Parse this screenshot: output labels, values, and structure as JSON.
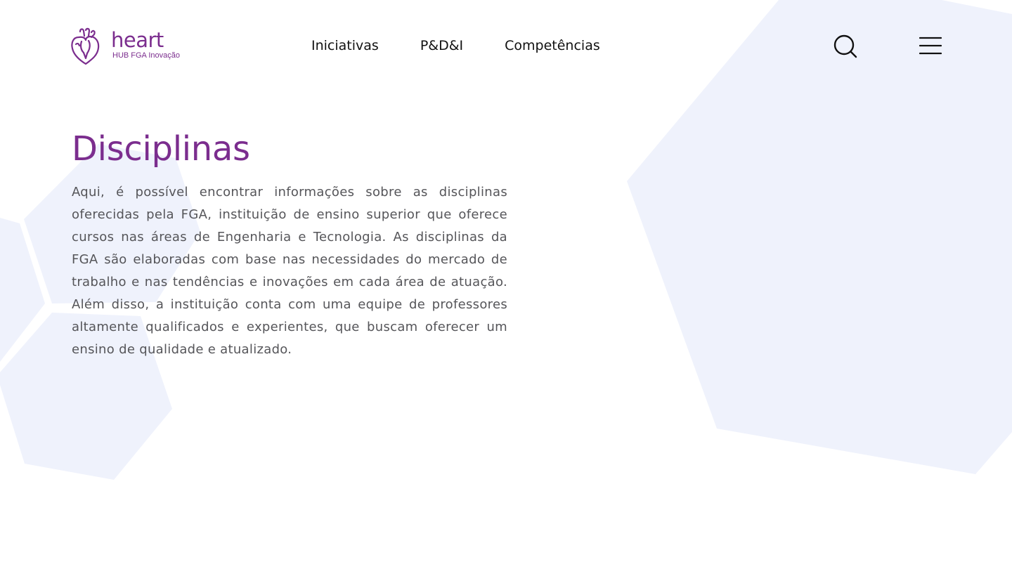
{
  "colors": {
    "brand": "#7b2d8e",
    "nav_text": "#111111",
    "body_text": "#555559",
    "hexagon_fill": "#eff2fc",
    "background": "#ffffff"
  },
  "header": {
    "logo": {
      "name": "heart",
      "subtitle": "HUB FGA Inovação",
      "icon": "anatomical-heart-icon"
    },
    "nav": [
      {
        "label": "Iniciativas"
      },
      {
        "label": "P&D&I"
      },
      {
        "label": "Competências"
      }
    ],
    "search_icon": "search-icon",
    "menu_icon": "hamburger-menu-icon"
  },
  "main": {
    "title": "Disciplinas",
    "description": "Aqui, é possível encontrar informações sobre as disciplinas oferecidas pela FGA, instituição de ensino superior que oferece cursos nas áreas de Engenharia e Tecnologia. As disciplinas da FGA são elaboradas com base nas necessidades do mercado de trabalho e nas tendências e inovações em cada área de atuação. Além disso, a instituição conta com uma equipe de professores altamente qualificados e experientes, que buscam oferecer um ensino de qualidade e atualizado."
  }
}
